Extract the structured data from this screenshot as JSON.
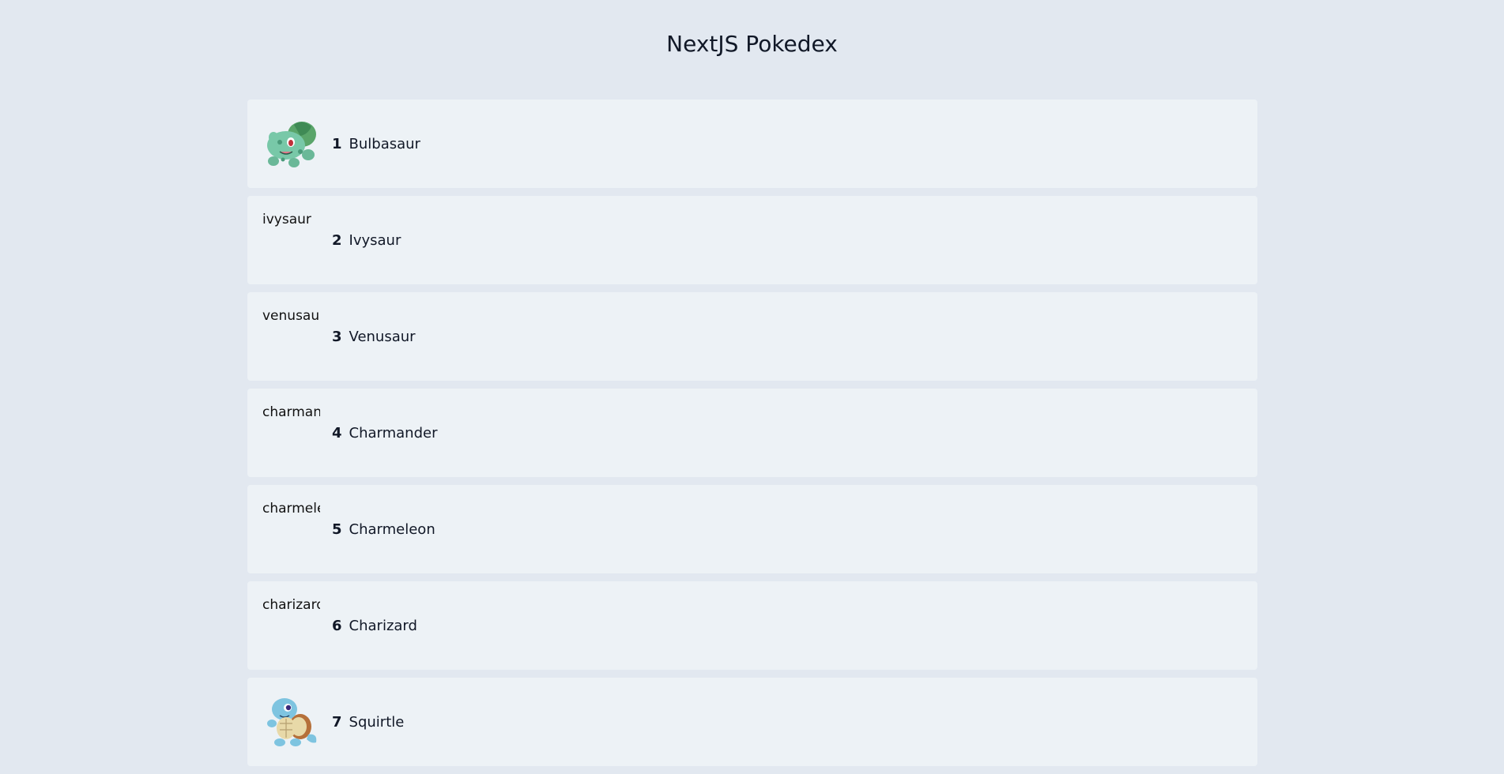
{
  "header": {
    "title": "NextJS Pokedex"
  },
  "pokemon": [
    {
      "id": "1",
      "name": "Bulbasaur",
      "sprite_alt": "bulbasaur",
      "has_image": true,
      "icon": "bulbasaur-sprite-icon"
    },
    {
      "id": "2",
      "name": "Ivysaur",
      "sprite_alt": "ivysaur",
      "has_image": false
    },
    {
      "id": "3",
      "name": "Venusaur",
      "sprite_alt": "venusaur",
      "has_image": false
    },
    {
      "id": "4",
      "name": "Charmander",
      "sprite_alt": "charmander",
      "has_image": false
    },
    {
      "id": "5",
      "name": "Charmeleon",
      "sprite_alt": "charmeleon",
      "has_image": false
    },
    {
      "id": "6",
      "name": "Charizard",
      "sprite_alt": "charizard",
      "has_image": false
    },
    {
      "id": "7",
      "name": "Squirtle",
      "sprite_alt": "squirtle",
      "has_image": true,
      "icon": "squirtle-sprite-icon"
    }
  ],
  "colors": {
    "background": "#e2e8f0",
    "card": "#edf2f6"
  }
}
